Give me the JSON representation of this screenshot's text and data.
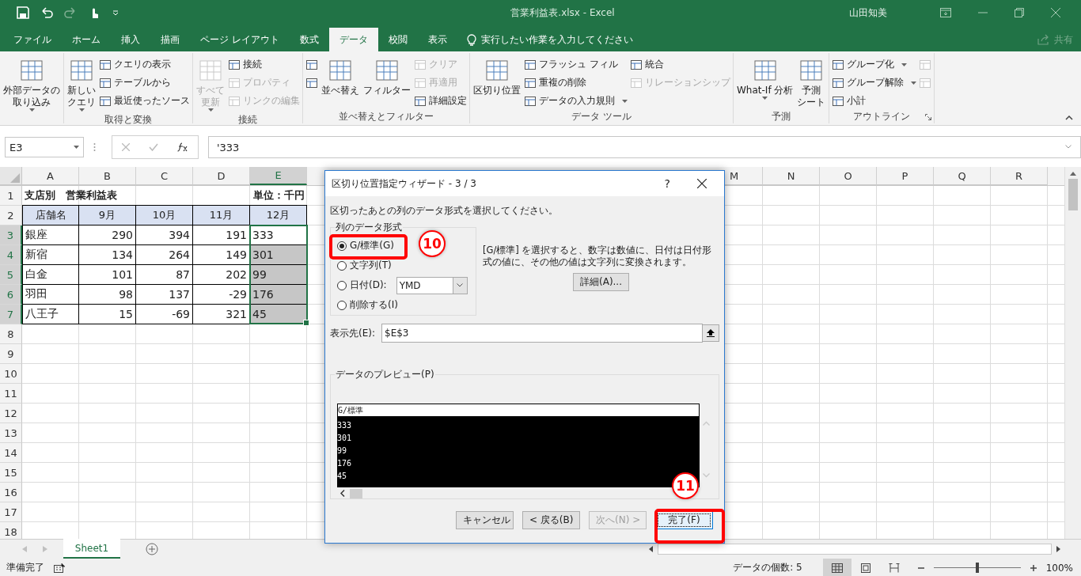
{
  "title_bar": {
    "title": "営業利益表.xlsx  -  Excel",
    "user": "山田知美"
  },
  "ribbon_tabs": [
    {
      "label": "ファイル",
      "selected": false
    },
    {
      "label": "ホーム",
      "selected": false
    },
    {
      "label": "挿入",
      "selected": false
    },
    {
      "label": "描画",
      "selected": false
    },
    {
      "label": "ページ レイアウト",
      "selected": false
    },
    {
      "label": "数式",
      "selected": false
    },
    {
      "label": "データ",
      "selected": true
    },
    {
      "label": "校閲",
      "selected": false
    },
    {
      "label": "表示",
      "selected": false
    }
  ],
  "tell_me": "実行したい作業を入力してください",
  "share": "共有",
  "ribbon_groups": [
    {
      "items": [
        {
          "kind": "large",
          "lines": [
            "外部データの",
            "取り込み"
          ],
          "dropdown": true,
          "disabled": false
        }
      ]
    },
    {
      "label": "取得と変換",
      "items": [
        {
          "kind": "large",
          "lines": [
            "新しい",
            "クエリ"
          ],
          "dropdown": true,
          "disabled": false
        },
        {
          "kind": "small",
          "label": "クエリの表示",
          "disabled": false
        },
        {
          "kind": "small",
          "label": "テーブルから",
          "disabled": false
        },
        {
          "kind": "small",
          "label": "最近使ったソース",
          "disabled": false
        }
      ]
    },
    {
      "label": "接続",
      "items": [
        {
          "kind": "large",
          "lines": [
            "すべて",
            "更新"
          ],
          "dropdown": true,
          "disabled": true
        },
        {
          "kind": "small",
          "label": "接続",
          "disabled": false
        },
        {
          "kind": "small",
          "label": "プロパティ",
          "disabled": true
        },
        {
          "kind": "small",
          "label": "リンクの編集",
          "disabled": true
        }
      ]
    },
    {
      "label": "並べ替えとフィルター",
      "items": [
        {
          "kind": "icon",
          "disabled": false
        },
        {
          "kind": "icon",
          "disabled": false
        },
        {
          "kind": "large",
          "lines": [
            "並べ替え"
          ],
          "disabled": false
        },
        {
          "kind": "large",
          "lines": [
            "フィルター"
          ],
          "disabled": false
        },
        {
          "kind": "small",
          "label": "クリア",
          "disabled": true
        },
        {
          "kind": "small",
          "label": "再適用",
          "disabled": true
        },
        {
          "kind": "small",
          "label": "詳細設定",
          "disabled": false
        }
      ]
    },
    {
      "label": "データ ツール",
      "items": [
        {
          "kind": "large",
          "lines": [
            "区切り位置"
          ],
          "disabled": false
        },
        {
          "kind": "small",
          "label": "フラッシュ フィル",
          "disabled": false
        },
        {
          "kind": "small",
          "label": "重複の削除",
          "disabled": false
        },
        {
          "kind": "small",
          "label": "データの入力規則",
          "dropdown": true,
          "disabled": false
        },
        {
          "kind": "small",
          "label": "統合",
          "disabled": false
        },
        {
          "kind": "small",
          "label": "リレーションシップ",
          "disabled": true
        }
      ]
    },
    {
      "label": "予測",
      "items": [
        {
          "kind": "large",
          "lines": [
            "What-If 分析"
          ],
          "dropdown": true,
          "disabled": false
        },
        {
          "kind": "large",
          "lines": [
            "予測",
            "シート"
          ],
          "disabled": false
        }
      ]
    },
    {
      "label": "アウトライン",
      "launcher": true,
      "items": [
        {
          "kind": "small",
          "label": "グループ化",
          "dropdown": true,
          "disabled": false
        },
        {
          "kind": "small",
          "label": "グループ解除",
          "dropdown": true,
          "disabled": false
        },
        {
          "kind": "small",
          "label": "小計",
          "disabled": false
        },
        {
          "kind": "icon",
          "disabled": true
        },
        {
          "kind": "icon",
          "disabled": true
        }
      ]
    }
  ],
  "formula_bar": {
    "name_box": "E3",
    "formula": "'333"
  },
  "sheet": {
    "columns": [
      {
        "label": "A",
        "selected": false
      },
      {
        "label": "B",
        "selected": false
      },
      {
        "label": "C",
        "selected": false
      },
      {
        "label": "D",
        "selected": false
      },
      {
        "label": "E",
        "selected": true
      },
      {
        "label": "M",
        "selected": false
      },
      {
        "label": "N",
        "selected": false
      },
      {
        "label": "O",
        "selected": false
      },
      {
        "label": "P",
        "selected": false
      },
      {
        "label": "Q",
        "selected": false
      },
      {
        "label": "R",
        "selected": false
      }
    ],
    "rows": [
      {
        "header": "1",
        "kind": "title",
        "selected": false,
        "cells": [
          "支店別　営業利益表",
          "単位：千円"
        ]
      },
      {
        "header": "2",
        "kind": "head",
        "selected": false,
        "cells": [
          "店舗名",
          "9月",
          "10月",
          "11月",
          "12月"
        ]
      },
      {
        "header": "3",
        "kind": "data",
        "selected": true,
        "highlighted": false,
        "cells": [
          "銀座",
          "290",
          "394",
          "191",
          "333"
        ]
      },
      {
        "header": "4",
        "kind": "data",
        "selected": true,
        "highlighted": true,
        "cells": [
          "新宿",
          "134",
          "264",
          "149",
          "301"
        ]
      },
      {
        "header": "5",
        "kind": "data",
        "selected": true,
        "highlighted": true,
        "cells": [
          "白金",
          "101",
          "87",
          "202",
          "99"
        ]
      },
      {
        "header": "6",
        "kind": "data",
        "selected": true,
        "highlighted": true,
        "cells": [
          "羽田",
          "98",
          "137",
          "-29",
          "176"
        ]
      },
      {
        "header": "7",
        "kind": "data",
        "selected": true,
        "highlighted": true,
        "cells": [
          "八王子",
          "15",
          "-69",
          "321",
          "45"
        ]
      },
      {
        "header": "8",
        "selected": false
      },
      {
        "header": "9",
        "selected": false
      },
      {
        "header": "10",
        "selected": false
      },
      {
        "header": "11",
        "selected": false
      },
      {
        "header": "12",
        "selected": false
      },
      {
        "header": "13",
        "selected": false
      },
      {
        "header": "14",
        "selected": false
      },
      {
        "header": "15",
        "selected": false
      },
      {
        "header": "16",
        "selected": false
      },
      {
        "header": "17",
        "selected": false
      },
      {
        "header": "18",
        "selected": false
      }
    ]
  },
  "dialog": {
    "title": "区切り位置指定ウィザード - 3 / 3",
    "help": "?",
    "instruction": "区切ったあとの列のデータ形式を選択してください。",
    "format_legend": "列のデータ形式",
    "formats": [
      {
        "label": "G/標準(G)",
        "selected": true
      },
      {
        "label": "文字列(T)",
        "selected": false
      },
      {
        "label": "日付(D):",
        "selected": false,
        "value": "YMD"
      },
      {
        "label": "削除する(I)",
        "selected": false
      }
    ],
    "description": "[G/標準] を選択すると、数字は数値に、日付は日付形式の値に、その他の値は文字列に変換されます。",
    "advanced_button": "詳細(A)...",
    "destination_label": "表示先(E):",
    "destination": "$E$3",
    "preview_legend": "データのプレビュー(P)",
    "preview_header": "G/標準",
    "preview_rows": [
      "333",
      "301",
      "99",
      "176",
      "45"
    ],
    "buttons": [
      {
        "label": "キャンセル",
        "disabled": false,
        "default": false
      },
      {
        "label": "< 戻る(B)",
        "disabled": false,
        "default": false
      },
      {
        "label": "次へ(N) >",
        "disabled": true,
        "default": false
      },
      {
        "label": "完了(F)",
        "disabled": false,
        "default": true
      }
    ]
  },
  "annotations": [
    {
      "label": "10",
      "kind": "format"
    },
    {
      "label": "11",
      "kind": "finish"
    }
  ],
  "sheet_tabs": [
    {
      "label": "Sheet1",
      "selected": true
    }
  ],
  "status_bar": {
    "mode": "準備完了",
    "count": "データの個数: 5",
    "views": [
      {
        "kind": "normal",
        "selected": true
      },
      {
        "kind": "layout",
        "selected": false
      },
      {
        "kind": "break",
        "selected": false
      }
    ],
    "zoom": {
      "level": 0.5,
      "reading": "100%"
    }
  }
}
